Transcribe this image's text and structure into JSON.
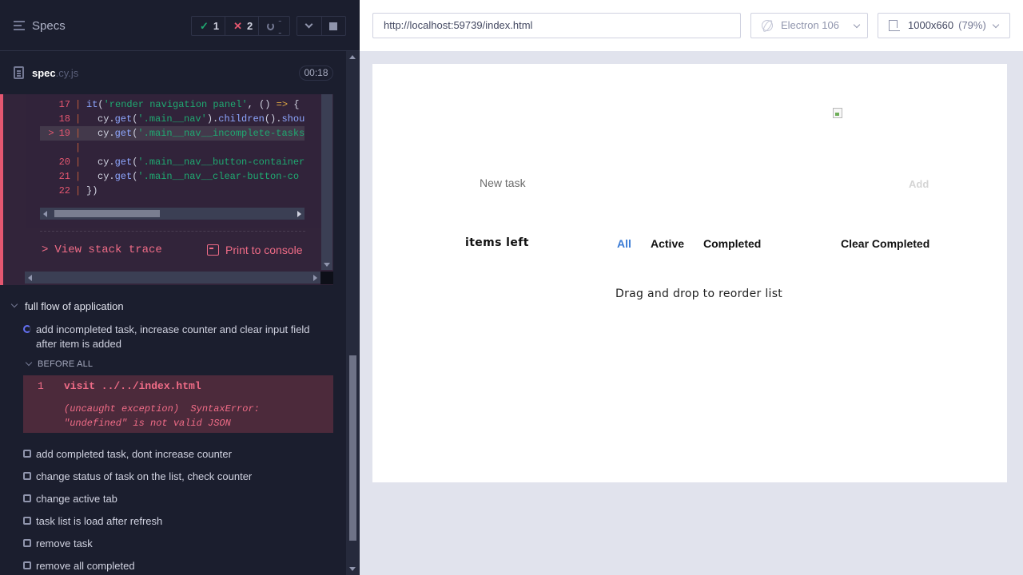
{
  "reporter": {
    "header": {
      "specs_label": "Specs",
      "passed_count": "1",
      "failed_count": "2",
      "pending_count": "--"
    },
    "spec": {
      "name": "spec",
      "ext": ".cy.js",
      "timer": "00:18"
    },
    "error": {
      "code_lines": [
        {
          "num": "17",
          "code": "it('render navigation panel', () => {"
        },
        {
          "num": "18",
          "code": "cy.get('.main__nav').children().should"
        },
        {
          "num": "> 19",
          "code": "cy.get('.main__nav__incomplete-tasks"
        },
        {
          "num": "",
          "code": ""
        },
        {
          "num": "20",
          "code": "cy.get('.main__nav__button-container"
        },
        {
          "num": "21",
          "code": "cy.get('.main__nav__clear-button-co"
        },
        {
          "num": "22",
          "code": "})"
        }
      ],
      "stack_trace_label": "View stack trace",
      "print_console_label": "Print to console"
    },
    "suite": {
      "title": "full flow of application",
      "running_test": "add incompleted task, increase counter and clear input field after item is added",
      "before_all_label": "BEFORE ALL",
      "command": {
        "number": "1",
        "name": "visit  ../../index.html",
        "message_line1": "(uncaught exception)  SyntaxError:",
        "message_line2": "\"undefined\" is not valid JSON"
      },
      "tests": [
        "add completed task, dont increase counter",
        "change status of task on the list, check counter",
        "change active tab",
        "task list is load after refresh",
        "remove task",
        "remove all completed"
      ]
    }
  },
  "aut": {
    "url": "http://localhost:59739/index.html",
    "browser": "Electron 106",
    "viewport": "1000x660",
    "zoom": "(79%)",
    "app": {
      "new_task_placeholder": "New task",
      "add_label": "Add",
      "items_left_label": "items left",
      "tabs": [
        "All",
        "Active",
        "Completed"
      ],
      "clear_completed_label": "Clear Completed",
      "drag_hint": "Drag and drop to reorder list"
    }
  },
  "colors": {
    "reporter_bg": "#1b1e2e",
    "error_red": "#e45770",
    "pass_green": "#1fa971",
    "active_tab_blue": "#3a7bd5"
  }
}
